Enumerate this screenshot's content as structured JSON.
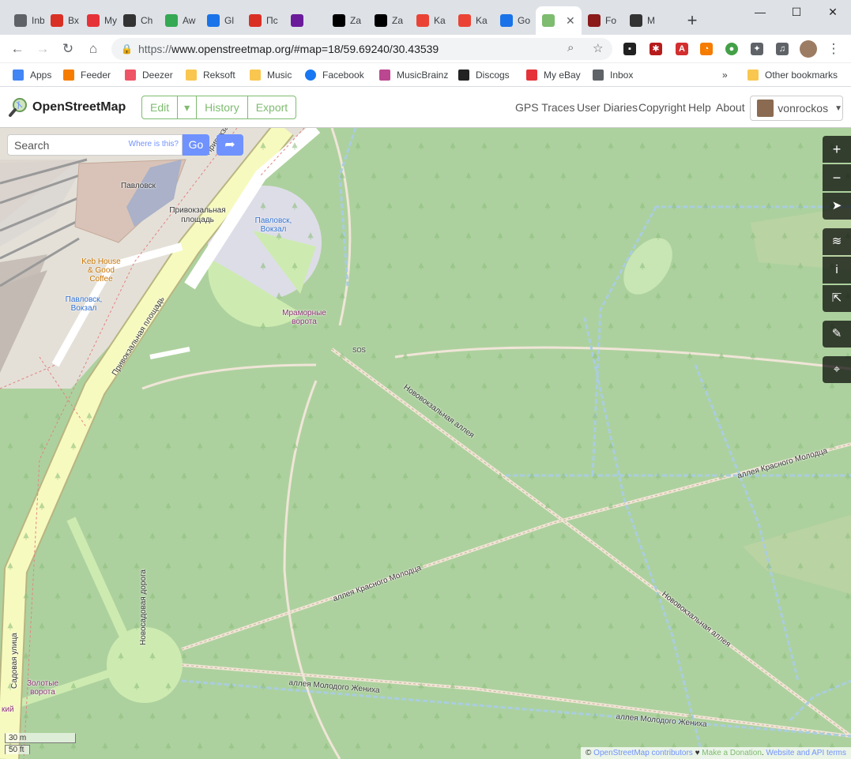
{
  "browser": {
    "tabs": [
      {
        "label": "Inb",
        "icon": "mail-icon",
        "color": "#5f6368"
      },
      {
        "label": "Вх",
        "icon": "gmail-icon",
        "color": "#d93025"
      },
      {
        "label": "My",
        "icon": "ebay-bag-icon",
        "color": "#e53238"
      },
      {
        "label": "Ch",
        "icon": "wikipedia-icon",
        "color": "#333333"
      },
      {
        "label": "Aw",
        "icon": "bars-icon",
        "color": "#34a853"
      },
      {
        "label": "Gl",
        "icon": "drop-icon",
        "color": "#1a73e8"
      },
      {
        "label": "Пс",
        "icon": "mushroom-icon",
        "color": "#d93025"
      },
      {
        "label": "",
        "icon": "music-icon",
        "color": "#6a1b9a"
      },
      {
        "label": "Za",
        "icon": "za-icon",
        "color": "#000000"
      },
      {
        "label": "Za",
        "icon": "za-icon",
        "color": "#000000"
      },
      {
        "label": "Ka",
        "icon": "map-pin-icon",
        "color": "#ea4335"
      },
      {
        "label": "Ka",
        "icon": "map-pin-icon",
        "color": "#ea4335"
      },
      {
        "label": "Go",
        "icon": "google-earth-icon",
        "color": "#1a73e8"
      },
      {
        "label": "",
        "icon": "osm-icon",
        "color": "#7ebc6f",
        "active": true
      },
      {
        "label": "Fo",
        "icon": "f-icon",
        "color": "#8b1a1a"
      },
      {
        "label": "M",
        "icon": "chess-icon",
        "color": "#333333"
      }
    ],
    "url_scheme": "https://",
    "url_rest": "www.openstreetmap.org/#map=18/59.69240/30.43539",
    "bookmarks": [
      {
        "label": "Apps",
        "icon": "apps-grid-icon"
      },
      {
        "label": "Feeder",
        "icon": "rss-icon"
      },
      {
        "label": "Deezer",
        "icon": "deezer-icon"
      },
      {
        "label": "Reksoft",
        "icon": "folder-icon"
      },
      {
        "label": "Music",
        "icon": "folder-icon"
      },
      {
        "label": "Facebook",
        "icon": "facebook-icon"
      },
      {
        "label": "MusicBrainz",
        "icon": "musicbrainz-icon"
      },
      {
        "label": "Discogs",
        "icon": "discogs-icon"
      },
      {
        "label": "My eBay",
        "icon": "ebay-bag-icon"
      },
      {
        "label": "Inbox",
        "icon": "mail-icon"
      }
    ],
    "bookmarks_more": "»",
    "other_bookmarks": "Other bookmarks"
  },
  "osm": {
    "site_name": "OpenStreetMap",
    "edit_label": "Edit",
    "history_label": "History",
    "export_label": "Export",
    "nav": [
      "GPS Traces",
      "User Diaries",
      "Copyright",
      "Help",
      "About"
    ],
    "username": "vonrockos"
  },
  "map": {
    "search_placeholder": "Search",
    "where_is_this": "Where is this?",
    "go_label": "Go",
    "labels": {
      "pavlovsk": "Павловск",
      "privokzalnaya_square": "Привокзальная площадь",
      "privokzalnaya_diag1": "Привокзальная площадь",
      "privokzalnaya_diag2": "Привокзальная площадь",
      "bus_stop_1": "Павловск, Вокзал",
      "bus_stop_2": "Павловск, Вокзал",
      "keb_house": "Keb House & Good Coffee",
      "marble_gate": "Мраморные ворота",
      "sos": "SOS",
      "novovokzalnaya_1": "Нововокзальная аллея",
      "novovokzalnaya_2": "Нововокзальная аллея",
      "krasnogo_molodtsa_1": "аллея Красного Молодца",
      "krasnogo_molodtsa_2": "аллея Красного Молодца",
      "molodogo_zhenikha_1": "аллея Молодого Жениха",
      "molodogo_zhenikha_2": "аллея Молодого Жениха",
      "novosadovaya": "Новосадовая дорога",
      "sadovaya": "Садовая улица",
      "zolotye_vorota": "Золотые ворота",
      "kiy": "кий"
    },
    "scale_metric": "30 m",
    "scale_imperial": "50 ft",
    "attribution_prefix": "© ",
    "attribution_contrib": "OpenStreetMap contributors",
    "attribution_heart": " ♥ ",
    "attribution_donate": "Make a Donation",
    "attribution_sep": ". ",
    "attribution_terms": "Website and API terms",
    "colors": {
      "park": "#add19e",
      "accent": "#7092ff",
      "osm_green": "#7ebc6f",
      "road_yellow": "#f7fabf"
    }
  }
}
